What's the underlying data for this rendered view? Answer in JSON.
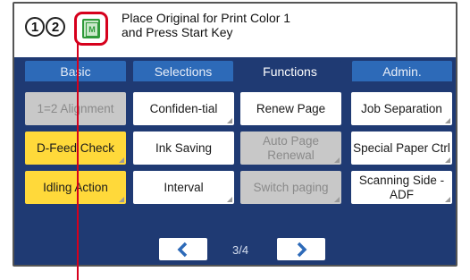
{
  "header": {
    "circle_nums": [
      "1",
      "2"
    ],
    "message_line1": "Place Original for Print Color 1",
    "message_line2": "and Press Start Key",
    "mode_icon_letter": "M"
  },
  "tabs": [
    {
      "label": "Basic",
      "active": false
    },
    {
      "label": "Selections",
      "active": false
    },
    {
      "label": "Functions",
      "active": true
    },
    {
      "label": "Admin.",
      "active": false
    }
  ],
  "functions": {
    "row1": [
      {
        "label": "1=2 Alignment",
        "state": "disabled"
      },
      {
        "label": "Confiden-tial",
        "state": "enabled"
      },
      {
        "label": "Renew Page",
        "state": "enabled"
      },
      {
        "label": "Job Separation",
        "state": "enabled"
      }
    ],
    "row2": [
      {
        "label": "D-Feed Check",
        "state": "active"
      },
      {
        "label": "Ink Saving",
        "state": "enabled"
      },
      {
        "label": "Auto Page Renewal",
        "state": "disabled"
      },
      {
        "label": "Special Paper Ctrl",
        "state": "enabled"
      }
    ],
    "row3": [
      {
        "label": "Idling Action",
        "state": "active"
      },
      {
        "label": "Interval",
        "state": "enabled"
      },
      {
        "label": "Switch paging",
        "state": "disabled"
      },
      {
        "label": "Scanning Side -ADF",
        "state": "enabled"
      }
    ]
  },
  "pager": {
    "text": "3/4",
    "prev_icon": "chevron-left-icon",
    "next_icon": "chevron-right-icon"
  },
  "colors": {
    "tab_bar": "#1f3a73",
    "tab": "#2d6ab8",
    "highlight": "#d6001c",
    "active_button": "#ffd93a"
  }
}
